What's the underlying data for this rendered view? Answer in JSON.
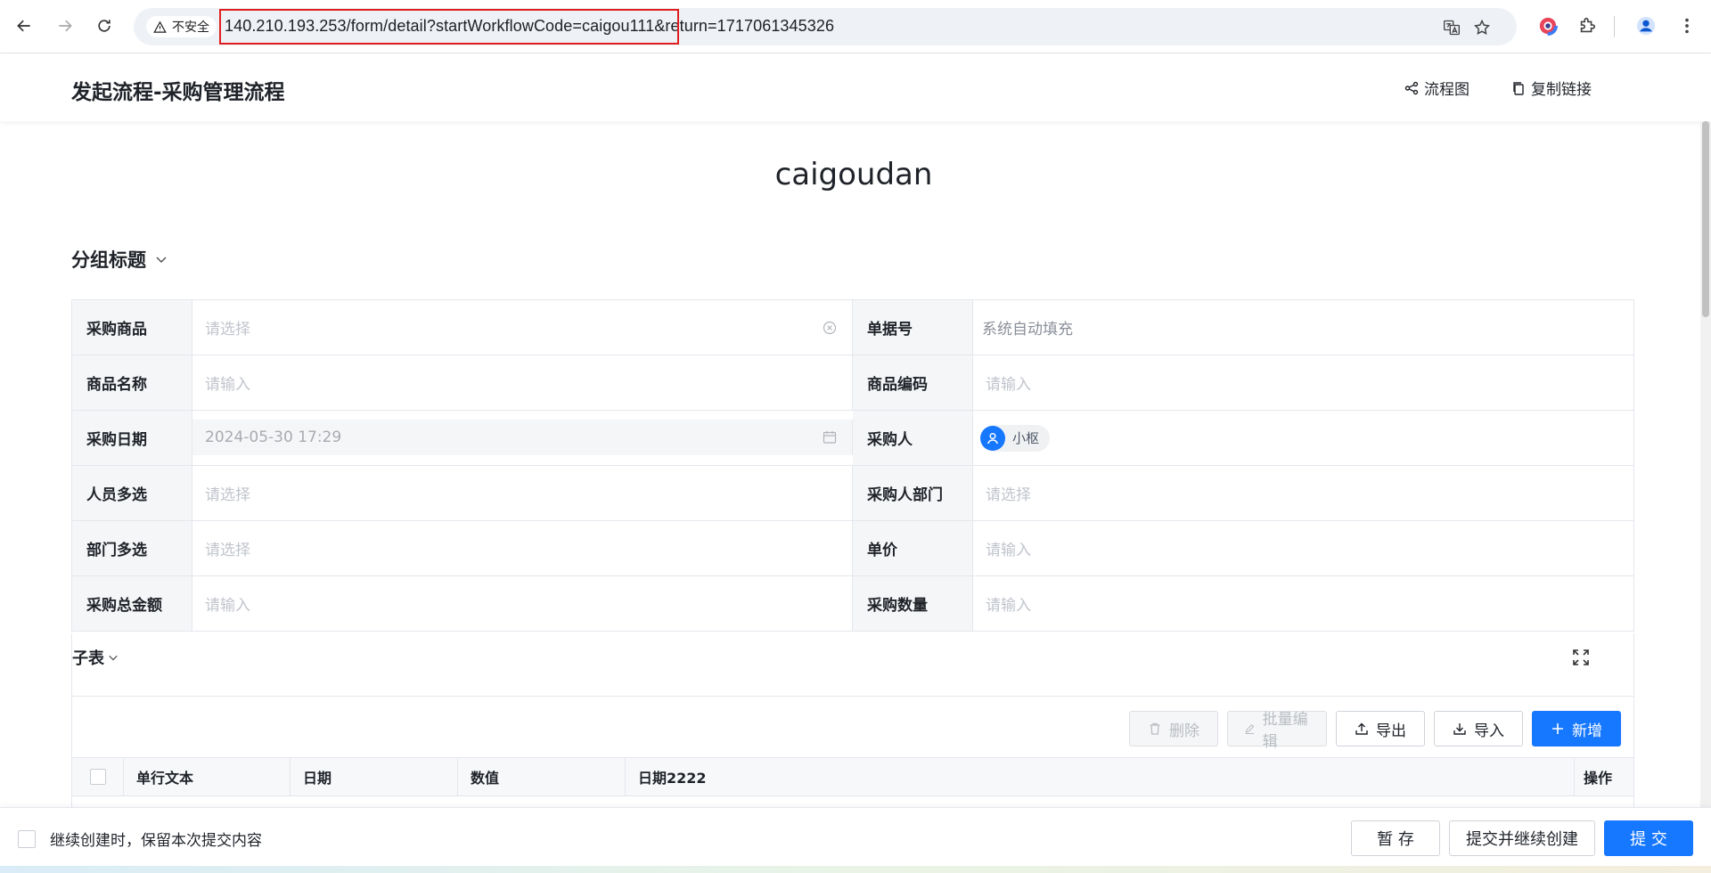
{
  "browser": {
    "security_label": "不安全",
    "url_highlighted": "140.210.193.253/form/detail?startWorkflowCode=caigou111",
    "url_rest": "&return=1717061345326"
  },
  "header": {
    "title": "发起流程-采购管理流程",
    "flowchart_label": "流程图",
    "copy_link_label": "复制链接"
  },
  "form": {
    "title": "caigoudan",
    "group_title": "分组标题",
    "rows": [
      {
        "left_label": "采购商品",
        "left_placeholder": "请选择",
        "right_label": "单据号",
        "right_value": "系统自动填充"
      },
      {
        "left_label": "商品名称",
        "left_placeholder": "请输入",
        "right_label": "商品编码",
        "right_placeholder": "请输入"
      },
      {
        "left_label": "采购日期",
        "left_value": "2024-05-30 17:29",
        "right_label": "采购人",
        "right_user": "小枢"
      },
      {
        "left_label": "人员多选",
        "left_placeholder": "请选择",
        "right_label": "采购人部门",
        "right_placeholder": "请选择"
      },
      {
        "left_label": "部门多选",
        "left_placeholder": "请选择",
        "right_label": "单价",
        "right_placeholder": "请输入"
      },
      {
        "left_label": "采购总金额",
        "left_placeholder": "请输入",
        "right_label": "采购数量",
        "right_placeholder": "请输入"
      }
    ]
  },
  "subtable": {
    "title": "子表",
    "buttons": {
      "delete": "删除",
      "batch_edit": "批量编辑",
      "export": "导出",
      "import": "导入",
      "add": "新增"
    },
    "columns": [
      "单行文本",
      "日期",
      "数值",
      "日期2222",
      "操作"
    ]
  },
  "footer": {
    "keep_label": "继续创建时，保留本次提交内容",
    "save_draft": "暂 存",
    "submit_continue": "提交并继续创建",
    "submit": "提 交"
  },
  "colors": {
    "primary": "#1677ff",
    "url_highlight_border": "#e02020"
  }
}
